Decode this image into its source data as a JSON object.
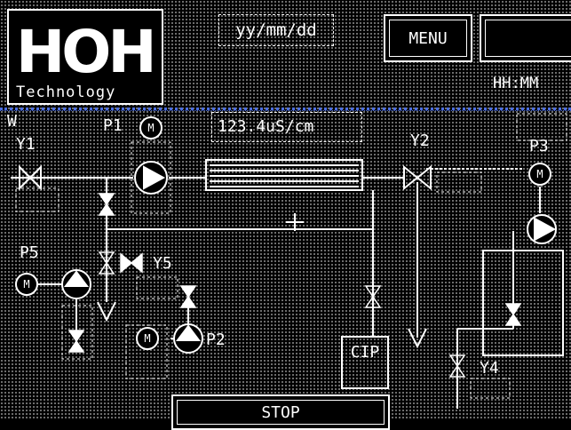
{
  "header": {
    "logo_main": "HOH",
    "logo_sub": "Technology",
    "date_format": "yy/mm/dd",
    "time_format": "HH:MM",
    "menu_label": "MENU"
  },
  "process": {
    "conductivity_reading": "123.4uS/cm",
    "labels": {
      "w": "W",
      "y1": "Y1",
      "p1": "P1",
      "y2": "Y2",
      "p3": "P3",
      "p5": "P5",
      "y5": "Y5",
      "p2": "P2",
      "cip": "CIP",
      "y4": "Y4"
    }
  },
  "footer": {
    "stop_label": "STOP"
  },
  "colors": {
    "background": "#000000",
    "foreground": "#ffffff",
    "divider": "#4b6ee0",
    "grid_dots": "#8a8a8a"
  }
}
